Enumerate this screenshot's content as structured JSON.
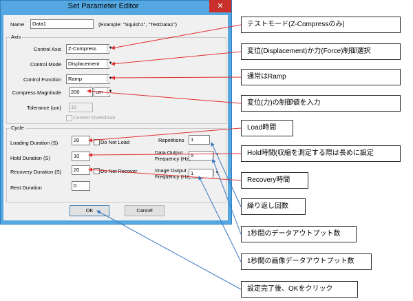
{
  "dialog": {
    "title": "Set Parameter Editor",
    "close_glyph": "✕",
    "name_label": "Name",
    "name_value": "Data1",
    "name_example": "(Example: \"Squish1\", \"TestData1\")"
  },
  "axis": {
    "group_label": "Axis",
    "control_axis_label": "Control Axis",
    "control_axis_value": "Z-Compress",
    "control_mode_label": "Control Mode",
    "control_mode_value": "Displacement",
    "control_function_label": "Control Function",
    "control_function_value": "Ramp",
    "compress_magnitude_label": "Compress Magnitude",
    "compress_magnitude_value": "200",
    "compress_unit": "um",
    "tolerance_label": "Tolerance (um)",
    "tolerance_value": "10",
    "correct_overshoot_label": "Correct Overshoot"
  },
  "cycle": {
    "group_label": "Cycle",
    "loading_duration_label": "Loading Duration (S)",
    "loading_duration_value": "20",
    "do_not_load_label": "Do Not Load",
    "hold_duration_label": "Hold Duration (S)",
    "hold_duration_value": "10",
    "recovery_duration_label": "Recovery Duration (S)",
    "recovery_duration_value": "20",
    "do_not_recover_label": "Do Not Recover",
    "rest_duration_label": "Rest Duration",
    "rest_duration_value": "0",
    "repetitions_label": "Repetitions",
    "repetitions_value": "1",
    "data_output_label_1": "Data Output",
    "data_output_label_2": "Frequency (Hz)",
    "data_output_value": "5",
    "image_output_label_1": "Image Output",
    "image_output_label_2": "Frequency (Hz)",
    "image_output_value": "1"
  },
  "buttons": {
    "ok": "OK",
    "cancel": "Cancel"
  },
  "callouts": [
    "テストモード(Z-Compressのみ)",
    "変位(Displacement)か力(Force)制御選択",
    "通常はRamp",
    "変位(力)の制御値を入力",
    "Load時間",
    "Hold時間(収縮を測定する際は長めに設定",
    "Recovery時間",
    "繰り返し回数",
    "1秒間のデータアウトプット数",
    "1秒間の画像データアウトプット数",
    "設定完了後、OKをクリック"
  ],
  "colors": {
    "title_bar": "#54a7e0",
    "close_button": "#c9302c",
    "arrow_red": "#e03030",
    "arrow_blue": "#3a78c0"
  },
  "icons": [
    "close-icon",
    "dropdown-arrow-icon",
    "checkbox-icon"
  ]
}
